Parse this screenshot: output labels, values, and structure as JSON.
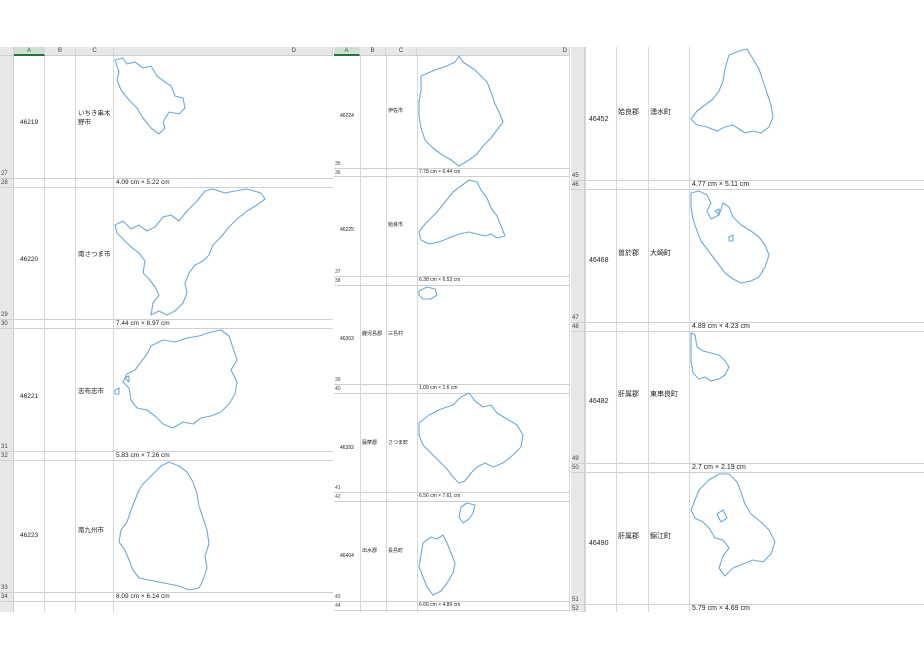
{
  "pane1": {
    "columns": [
      "A",
      "B",
      "C",
      "D"
    ],
    "selected_column": "A",
    "entries": [
      {
        "code": "46219",
        "name": "いちき串木野市",
        "dim": "4.09 cm × 5.22 cm",
        "row_top": "27",
        "row_dim": "28"
      },
      {
        "code": "46220",
        "name": "南さつま市",
        "dim": "7.44 cm × 8.97 cm",
        "row_top": "29",
        "row_dim": "30"
      },
      {
        "code": "46221",
        "name": "志布志市",
        "dim": "5.83 cm × 7.26 cm",
        "row_top": "31",
        "row_dim": "32"
      },
      {
        "code": "46223",
        "name": "南九州市",
        "dim": "8.09 cm × 6.14 cm",
        "row_top": "33",
        "row_dim": "34"
      }
    ]
  },
  "pane2": {
    "columns": [
      "A",
      "B",
      "C",
      "D"
    ],
    "selected_column": "A",
    "entries": [
      {
        "code": "46224",
        "district": "",
        "name": "伊佐市",
        "dim": "7.78 cm × 6.44 cm",
        "row_top": "35",
        "row_dim": "36"
      },
      {
        "code": "46225",
        "district": "",
        "name": "姶良市",
        "dim": "6.38 cm × 6.53 cm",
        "row_top": "37",
        "row_dim": "38"
      },
      {
        "code": "46303",
        "district": "鹿児島郡",
        "name": "三島村",
        "dim": "1.09 cm × 1.6 cm",
        "row_top": "39",
        "row_dim": "40"
      },
      {
        "code": "46392",
        "district": "薩摩郡",
        "name": "さつま町",
        "dim": "6.56 cm × 7.61 cm",
        "row_top": "41",
        "row_dim": "42"
      },
      {
        "code": "46404",
        "district": "出水郡",
        "name": "長島町",
        "dim": "6.66 cm × 4.89 cm",
        "row_top": "43",
        "row_dim": "44"
      }
    ]
  },
  "pane3": {
    "entries": [
      {
        "code": "46452",
        "district": "姶良郡",
        "name": "湧水町",
        "dim": "4.77 cm × 5.11 cm",
        "row_top": "45",
        "row_dim": "46"
      },
      {
        "code": "46468",
        "district": "曽於郡",
        "name": "大崎町",
        "dim": "4.89 cm × 4.23 cm",
        "row_top": "47",
        "row_dim": "48"
      },
      {
        "code": "46482",
        "district": "肝属郡",
        "name": "東串良町",
        "dim": "2.7 cm × 2.19 cm",
        "row_top": "49",
        "row_dim": "50"
      },
      {
        "code": "46490",
        "district": "肝属郡",
        "name": "錦江町",
        "dim": "5.79 cm × 4.69 cm",
        "row_top": "51",
        "row_dim": "52"
      }
    ]
  },
  "colors": {
    "outline": "#6fa8d8",
    "selected_header": "#217346",
    "grid": "#d0d0d0"
  }
}
